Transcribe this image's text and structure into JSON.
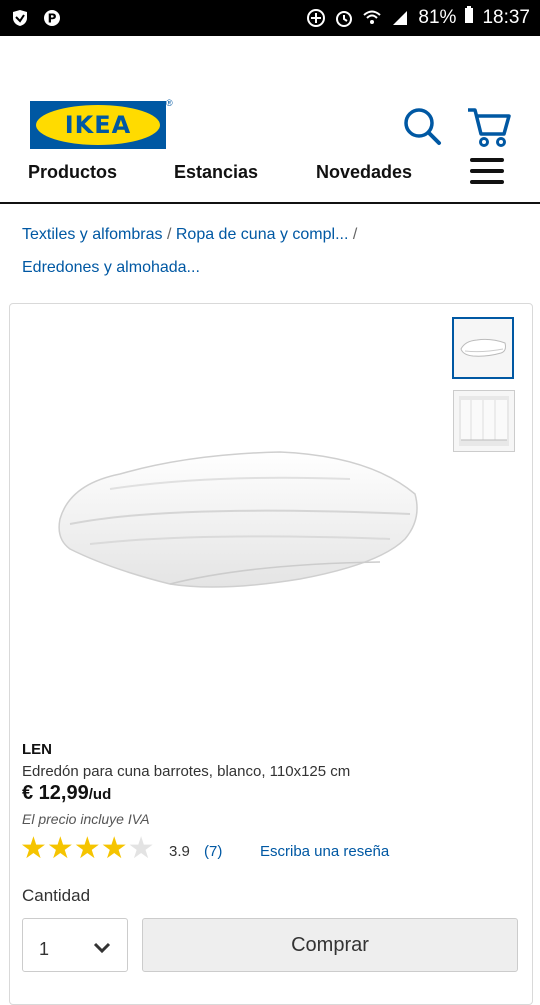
{
  "status_bar": {
    "battery": "81%",
    "time": "18:37"
  },
  "header": {
    "logo_text": "IKEA",
    "logo_colors": {
      "blue": "#0058a3",
      "yellow": "#ffdb00"
    }
  },
  "nav": {
    "items": [
      "Productos",
      "Estancias",
      "Novedades"
    ],
    "menu_icon": "hamburger-icon"
  },
  "breadcrumb": {
    "items": [
      "Textiles y alfombras",
      "Ropa de cuna y compl...",
      "Edredones y almohada..."
    ],
    "separator": "/"
  },
  "product": {
    "name": "LEN",
    "description": "Edredón para cuna barrotes, blanco, 110x125 cm",
    "price": "€ 12,99",
    "unit": "/ud",
    "vat_note": "El precio incluye IVA",
    "rating": "3.9",
    "rating_stars_filled": 4,
    "rating_stars_total": 5,
    "review_count": "(7)",
    "write_review": "Escriba una reseña",
    "quantity_label": "Cantidad",
    "quantity_value": "1",
    "buy_label": "Comprar",
    "accent_link_color": "#0058a3",
    "star_color": "#f5c400"
  }
}
